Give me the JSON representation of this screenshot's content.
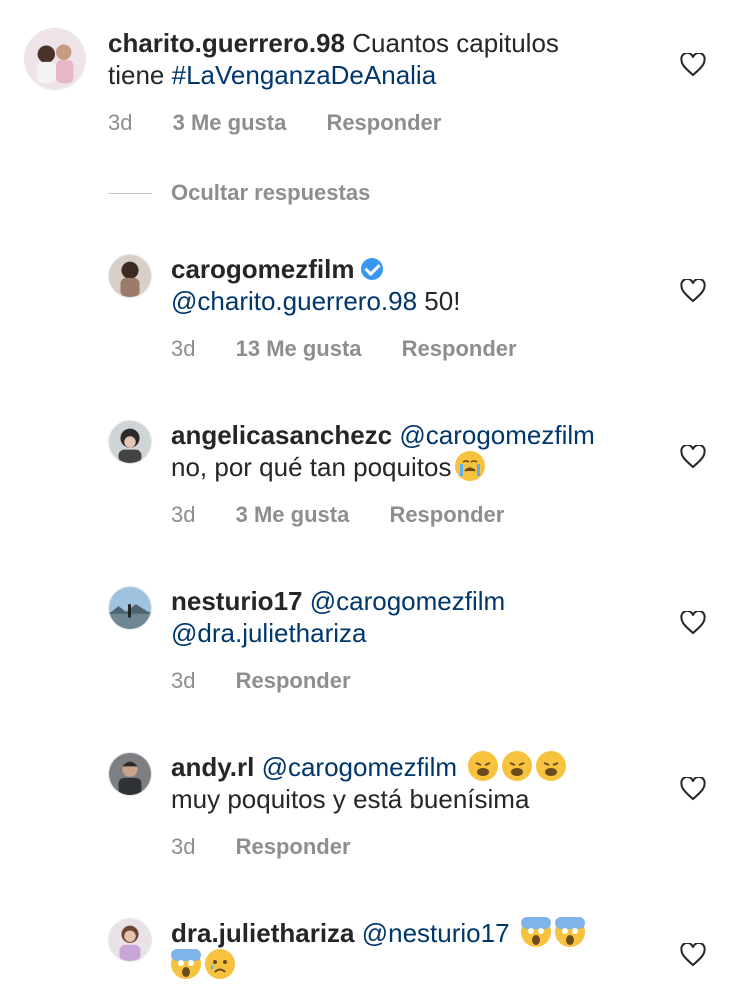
{
  "comments": [
    {
      "username": "charito.guerrero.98",
      "text_line1": "Cuantos capitulos",
      "text_line2_prefix": "tiene ",
      "hashtag": "#LaVenganzaDeAnalia",
      "time": "3d",
      "likes": "3 Me gusta",
      "reply": "Responder"
    }
  ],
  "hide_replies_label": "Ocultar respuestas",
  "replies": [
    {
      "username": "carogomezfilm",
      "verified": true,
      "mention": "@charito.guerrero.98",
      "text": " 50!",
      "time": "3d",
      "likes": "13 Me gusta",
      "reply": "Responder"
    },
    {
      "username": "angelicasanchezc",
      "mention": "@carogomezfilm",
      "text": "no, por qué tan poquitos",
      "emoji": "crying-face",
      "time": "3d",
      "likes": "3 Me gusta",
      "reply": "Responder"
    },
    {
      "username": "nesturio17",
      "mention": "@carogomezfilm",
      "mention2": "@dra.juliethariza",
      "time": "3d",
      "reply": "Responder"
    },
    {
      "username": "andy.rl",
      "mention": "@carogomezfilm",
      "emoji": "weary-face",
      "text": "muy poquitos y está buenísima",
      "time": "3d",
      "reply": "Responder"
    },
    {
      "username": "dra.juliethariza",
      "mention": "@nesturio17",
      "emoji": "screaming-face",
      "emoji2": "sad-tear-face"
    }
  ],
  "colors": {
    "text": "#262626",
    "mention": "#00376b",
    "secondary": "#8e8e8e",
    "verified": "#3897f0"
  }
}
